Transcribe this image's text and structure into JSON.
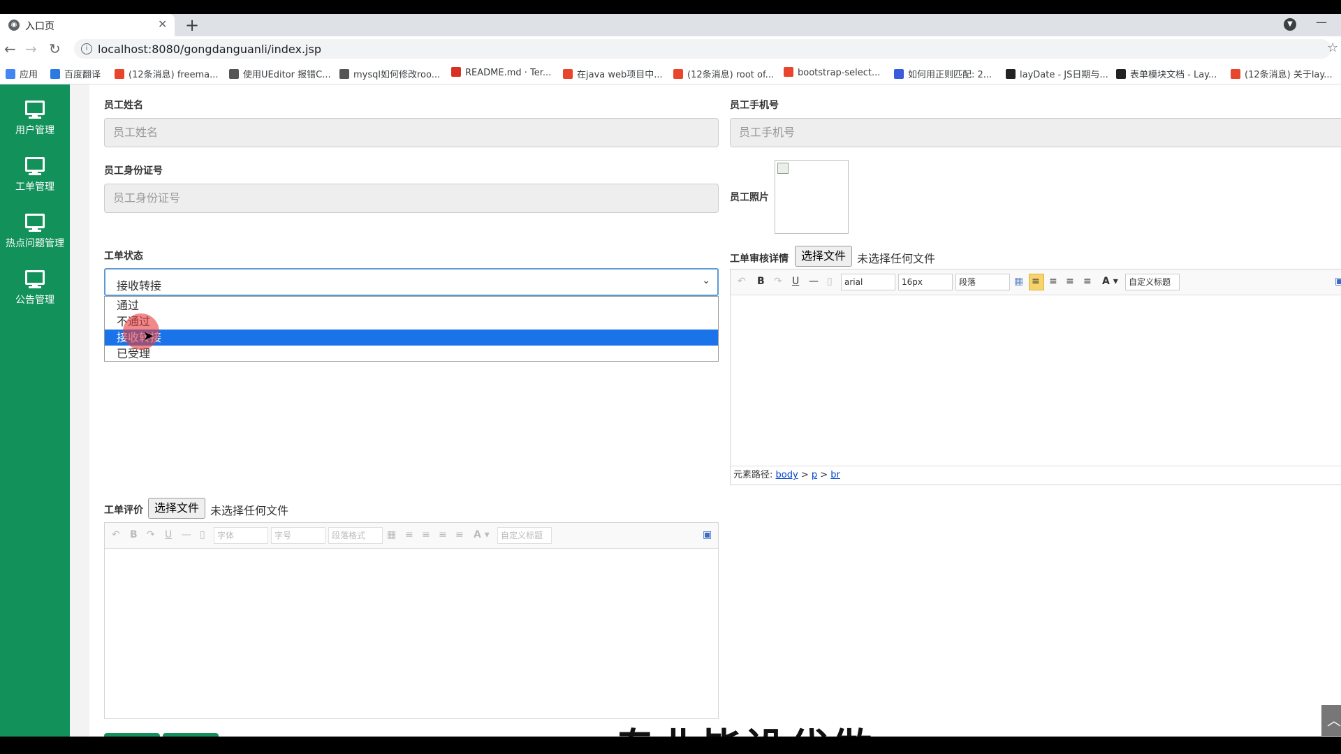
{
  "browser": {
    "tab_title": "入口页",
    "url": "localhost:8080/gongdanguanli/index.jsp",
    "bookmarks": [
      {
        "label": "应用",
        "color": "#4285f4"
      },
      {
        "label": "百度翻译",
        "color": "#2a7ae2"
      },
      {
        "label": "(12条消息) freema...",
        "color": "#e8452c"
      },
      {
        "label": "使用UEditor 报错C...",
        "color": "#555555"
      },
      {
        "label": "mysql如何修改roo...",
        "color": "#555555"
      },
      {
        "label": "README.md · Ter...",
        "color": "#d93025"
      },
      {
        "label": "在java web项目中...",
        "color": "#e8452c"
      },
      {
        "label": "(12条消息) root of...",
        "color": "#e8452c"
      },
      {
        "label": "bootstrap-select...",
        "color": "#e8452c"
      },
      {
        "label": "如何用正则匹配: 2...",
        "color": "#3b5bdb"
      },
      {
        "label": "layDate - JS日期与...",
        "color": "#222222"
      },
      {
        "label": "表单模块文档 - Lay...",
        "color": "#222222"
      },
      {
        "label": "(12条消息) 关于lay...",
        "color": "#e8452c"
      }
    ]
  },
  "sidebar": {
    "items": [
      {
        "label": "用户管理"
      },
      {
        "label": "工单管理"
      },
      {
        "label": "热点问题管理"
      },
      {
        "label": "公告管理"
      }
    ]
  },
  "form": {
    "name_label": "员工姓名",
    "name_placeholder": "员工姓名",
    "phone_label": "员工手机号",
    "phone_placeholder": "员工手机号",
    "idcard_label": "员工身份证号",
    "idcard_placeholder": "员工身份证号",
    "photo_label": "员工照片",
    "status_label": "工单状态",
    "status_value": "接收转接",
    "status_options": [
      "通过",
      "不通过",
      "接收转接",
      "已受理"
    ],
    "status_selected_index": 2,
    "review_label": "工单审核详情",
    "evaluation_label": "工单评价",
    "file_button": "选择文件",
    "file_none": "未选择任何文件"
  },
  "editor_review": {
    "font": "arial",
    "size": "16px",
    "paragraph": "段落",
    "custom_title": "自定义标题",
    "path_label": "元素路径:",
    "path_body": "body",
    "path_p": "p",
    "path_br": "br"
  },
  "editor_eval": {
    "font": "字体",
    "size": "字号",
    "paragraph": "段落格式",
    "custom_title": "自定义标题"
  },
  "overlay": {
    "watermark": "专业毕设代做"
  }
}
